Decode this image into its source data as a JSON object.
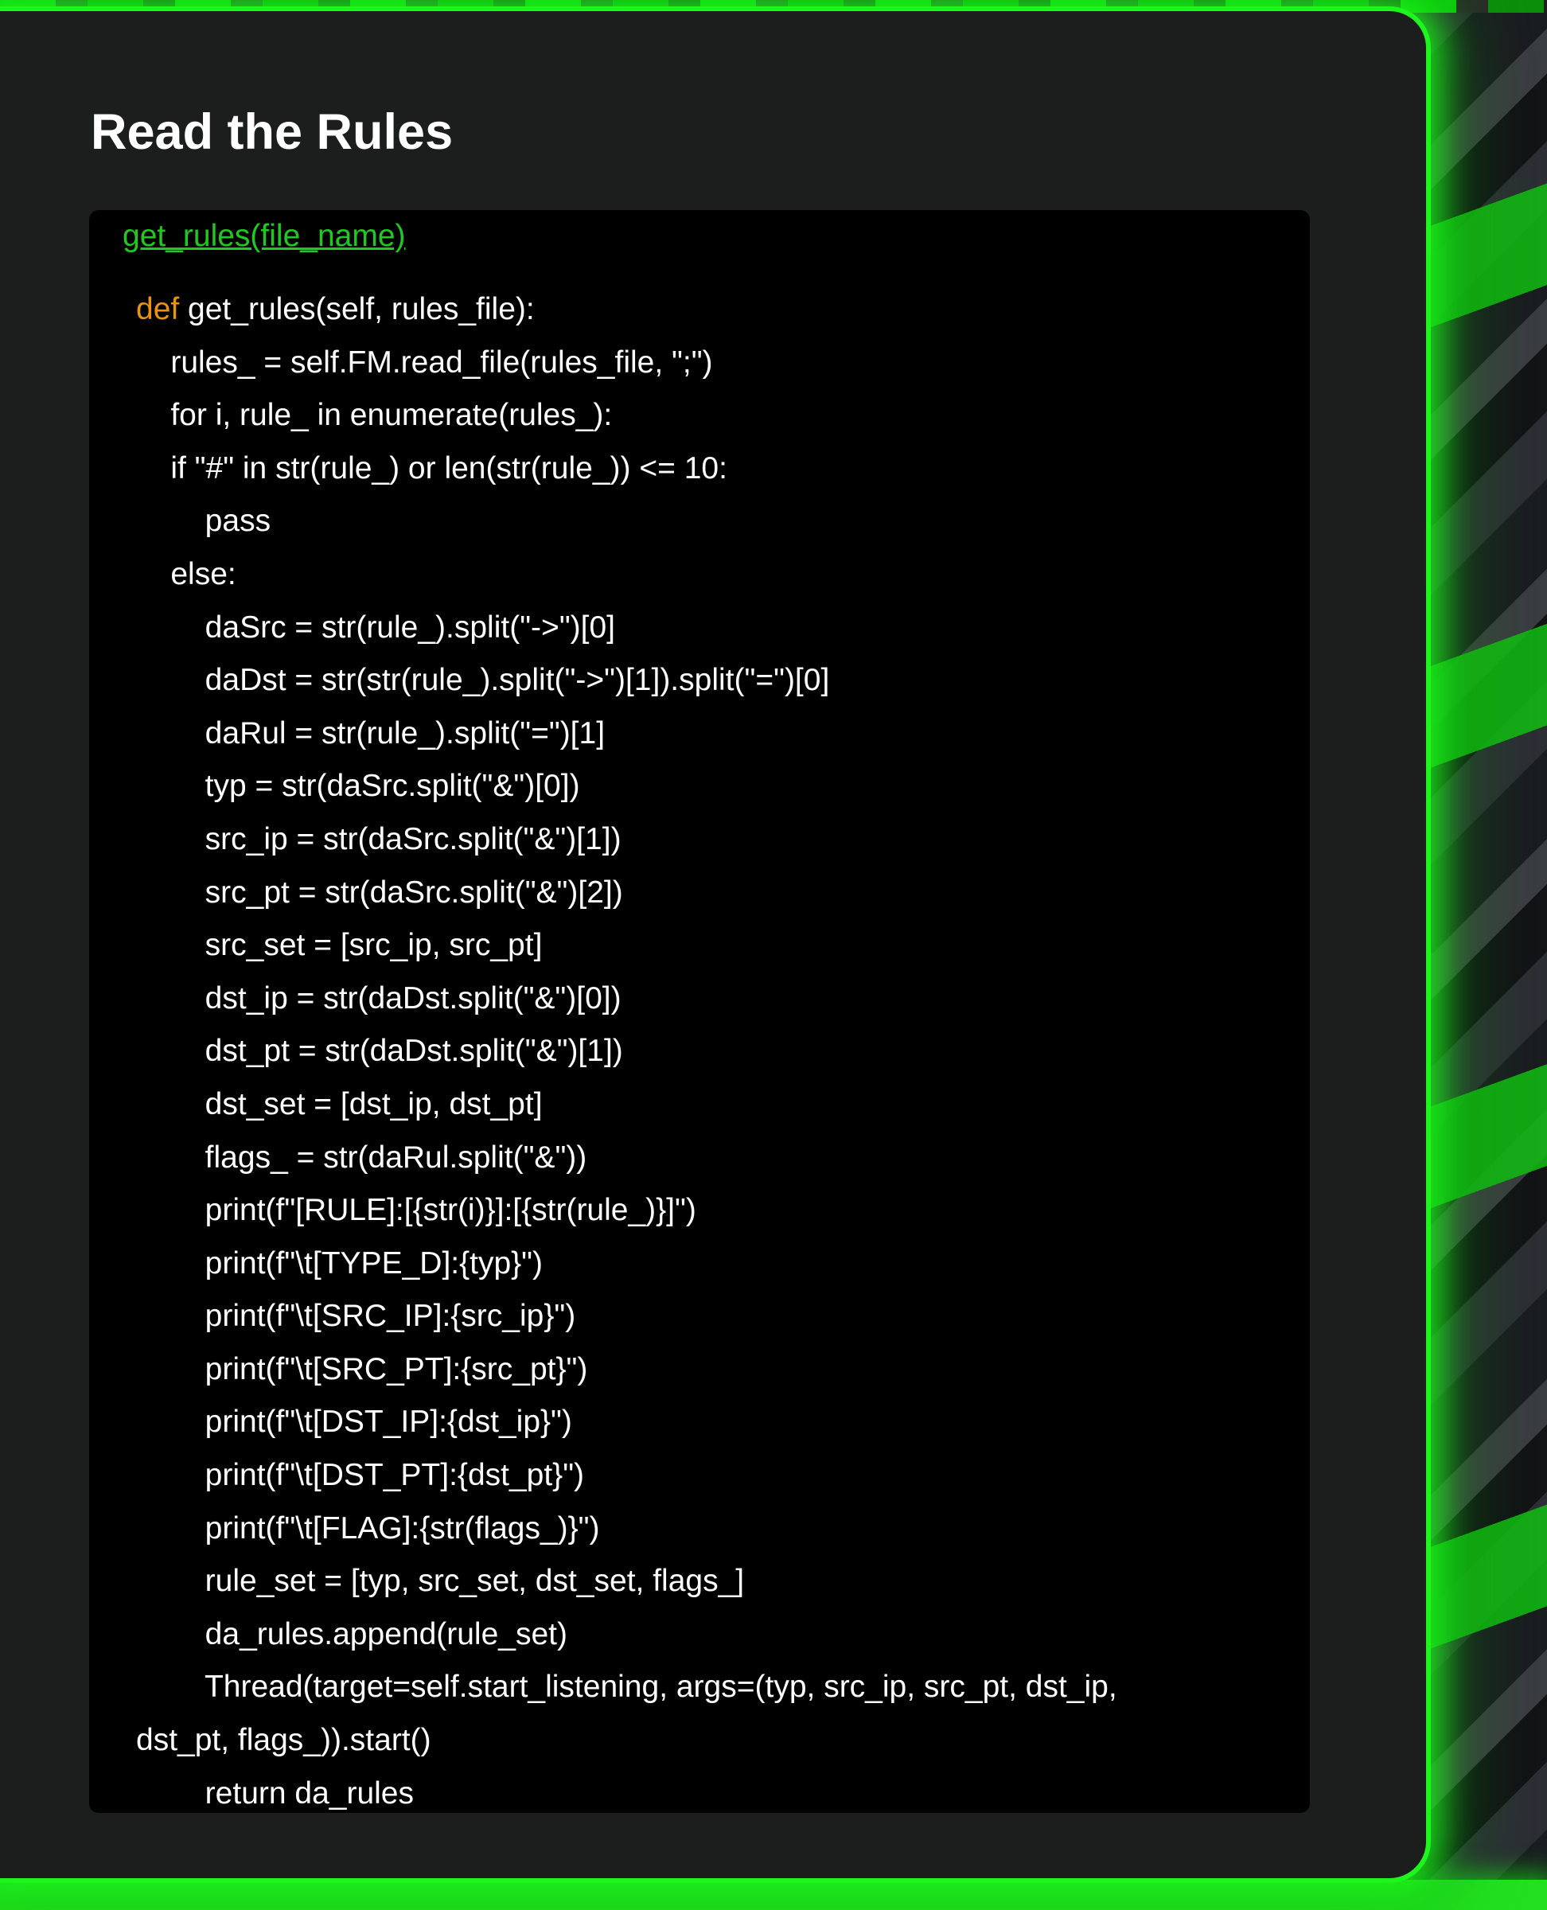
{
  "section": {
    "title": "Read the Rules"
  },
  "code_block": {
    "link_text": "get_rules(file_name)",
    "def_keyword": "def",
    "def_rest": " get_rules(self, rules_file):",
    "lines": [
      "    rules_ = self.FM.read_file(rules_file, \";\")",
      "    for i, rule_ in enumerate(rules_):",
      "    if \"#\" in str(rule_) or len(str(rule_)) <= 10:",
      "        pass",
      "    else:",
      "        daSrc = str(rule_).split(\"->\")[0]",
      "        daDst = str(str(rule_).split(\"->\")[1]).split(\"=\")[0]",
      "        daRul = str(rule_).split(\"=\")[1]",
      "        typ = str(daSrc.split(\"&\")[0])",
      "        src_ip = str(daSrc.split(\"&\")[1])",
      "        src_pt = str(daSrc.split(\"&\")[2])",
      "        src_set = [src_ip, src_pt]",
      "        dst_ip = str(daDst.split(\"&\")[0])",
      "        dst_pt = str(daDst.split(\"&\")[1])",
      "        dst_set = [dst_ip, dst_pt]",
      "        flags_ = str(daRul.split(\"&\"))",
      "        print(f\"[RULE]:[{str(i)}]:[{str(rule_)}]\")",
      "        print(f\"\\t[TYPE_D]:{typ}\")",
      "        print(f\"\\t[SRC_IP]:{src_ip}\")",
      "        print(f\"\\t[SRC_PT]:{src_pt}\")",
      "        print(f\"\\t[DST_IP]:{dst_ip}\")",
      "        print(f\"\\t[DST_PT]:{dst_pt}\")",
      "        print(f\"\\t[FLAG]:{str(flags_)}\")",
      "        rule_set = [typ, src_set, dst_set, flags_]",
      "        da_rules.append(rule_set)",
      "        Thread(target=self.start_listening, args=(typ, src_ip, src_pt, dst_ip,",
      "dst_pt, flags_)).start()",
      "        return da_rules"
    ]
  },
  "colors": {
    "accent_green": "#1fc91f",
    "keyword_orange": "#e8940f",
    "panel_background": "#1c1d1d",
    "code_background": "#000000"
  }
}
